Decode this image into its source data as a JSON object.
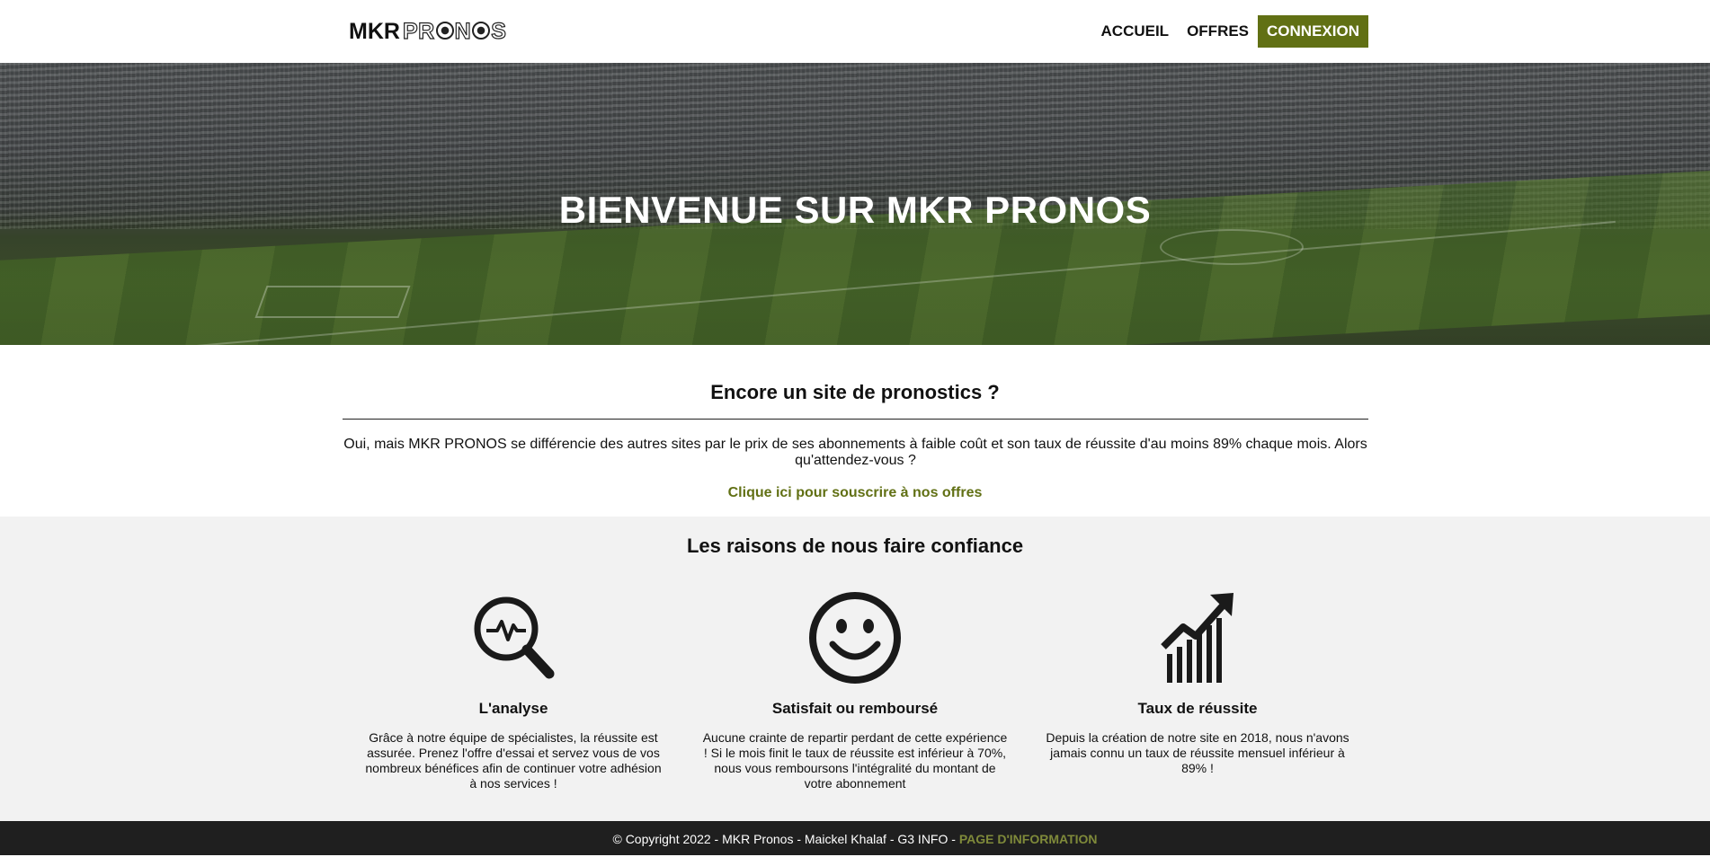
{
  "header": {
    "logo_part1": "MKR",
    "logo_part2a": "PR",
    "logo_part2b": "N",
    "logo_part2c": "S",
    "nav": {
      "home": "ACCUEIL",
      "offers": "OFFRES",
      "login": "CONNEXION"
    },
    "accent_color": "#617014"
  },
  "hero": {
    "title": "BIENVENUE SUR MKR PRONOS"
  },
  "intro": {
    "title": "Encore un site de pronostics ?",
    "text": "Oui, mais MKR PRONOS se différencie des autres sites par le prix de ses abonnements à faible coût et son taux de réussite d'au moins 89% chaque mois. Alors qu'attendez-vous ?",
    "link": "Clique ici pour souscrire à nos offres"
  },
  "reasons": {
    "title": "Les raisons de nous faire confiance",
    "items": [
      {
        "icon": "magnifier-pulse-icon",
        "title": "L'analyse",
        "text": "Grâce à notre équipe de spécialistes, la réussite est assurée. Prenez l'offre d'essai et servez vous de vos nombreux bénéfices afin de continuer votre adhésion à nos services !"
      },
      {
        "icon": "smiley-icon",
        "title": "Satisfait ou remboursé",
        "text": "Aucune crainte de repartir perdant de cette expérience ! Si le mois finit le taux de réussite est inférieur à 70%, nous vous remboursons l'intégralité du montant de votre abonnement"
      },
      {
        "icon": "growth-chart-icon",
        "title": "Taux de réussite",
        "text": "Depuis la création de notre site en 2018, nous n'avons jamais connu un taux de réussite mensuel inférieur à 89% !"
      }
    ]
  },
  "footer": {
    "text": "© Copyright 2022 - MKR Pronos - Maickel Khalaf - G3 INFO - ",
    "link": "PAGE D'INFORMATION"
  }
}
